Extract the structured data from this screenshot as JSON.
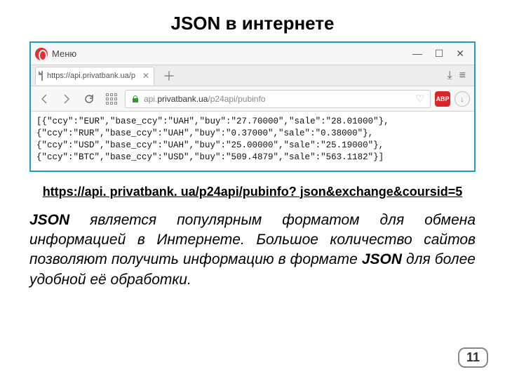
{
  "title": "JSON в интернете",
  "browser": {
    "menu_label": "Меню",
    "window_buttons": {
      "min": "—",
      "max": "☐",
      "close": "✕"
    },
    "tab_text": "https://api.privatbank.ua/p",
    "tab_close": "✕",
    "new_tab": "＋",
    "tab_end_download": "⤓",
    "tab_end_menu": "≡",
    "url_display_prefix": "api.",
    "url_display_host": "privatbank.ua",
    "url_display_path": "/p24api/pubinfo",
    "abp": "ABP",
    "dl_glyph": "↓",
    "heart": "♡"
  },
  "response_text": "[{\"ccy\":\"EUR\",\"base_ccy\":\"UAH\",\"buy\":\"27.70000\",\"sale\":\"28.01000\"},\n{\"ccy\":\"RUR\",\"base_ccy\":\"UAH\",\"buy\":\"0.37000\",\"sale\":\"0.38000\"},\n{\"ccy\":\"USD\",\"base_ccy\":\"UAH\",\"buy\":\"25.00000\",\"sale\":\"25.19000\"},\n{\"ccy\":\"BTC\",\"base_ccy\":\"USD\",\"buy\":\"509.4879\",\"sale\":\"563.1182\"}]",
  "link_text": "https://api. privatbank. ua/p24api/pubinfo? json&exchange&coursid=5",
  "paragraph": {
    "json1": "JSON",
    "t1": " является популярным форматом для обмена информацией в Интернете. Большое количество сайтов позволяют получить информацию в формате ",
    "json2": "JSON",
    "t2": " для более удобной её обработки."
  },
  "page_number": "11"
}
